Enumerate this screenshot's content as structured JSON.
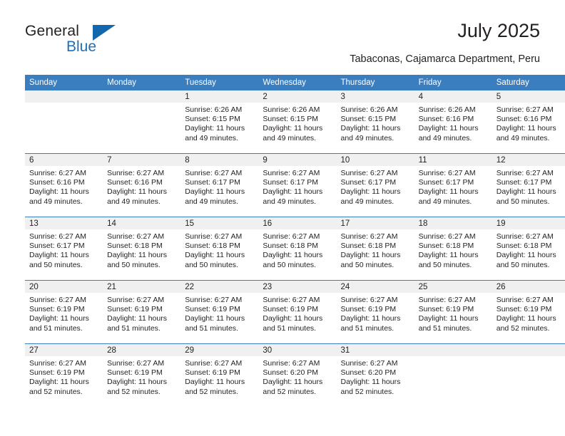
{
  "logo": {
    "word_one": "General",
    "word_two": "Blue",
    "triangle_icon": "triangle-icon",
    "brand_color": "#1368ad"
  },
  "header": {
    "title": "July 2025",
    "subtitle": "Tabaconas, Cajamarca Department, Peru"
  },
  "calendar": {
    "header_bg": "#3a7ebf",
    "daynum_band_bg": "#f0f0f0",
    "weekday_headers": [
      "Sunday",
      "Monday",
      "Tuesday",
      "Wednesday",
      "Thursday",
      "Friday",
      "Saturday"
    ],
    "weeks": [
      [
        {
          "day": "",
          "sunrise": "",
          "sunset": "",
          "daylight_line1": "",
          "daylight_line2": "",
          "empty": true
        },
        {
          "day": "",
          "sunrise": "",
          "sunset": "",
          "daylight_line1": "",
          "daylight_line2": "",
          "empty": true
        },
        {
          "day": "1",
          "sunrise": "Sunrise: 6:26 AM",
          "sunset": "Sunset: 6:15 PM",
          "daylight_line1": "Daylight: 11 hours",
          "daylight_line2": "and 49 minutes.",
          "empty": false
        },
        {
          "day": "2",
          "sunrise": "Sunrise: 6:26 AM",
          "sunset": "Sunset: 6:15 PM",
          "daylight_line1": "Daylight: 11 hours",
          "daylight_line2": "and 49 minutes.",
          "empty": false
        },
        {
          "day": "3",
          "sunrise": "Sunrise: 6:26 AM",
          "sunset": "Sunset: 6:15 PM",
          "daylight_line1": "Daylight: 11 hours",
          "daylight_line2": "and 49 minutes.",
          "empty": false
        },
        {
          "day": "4",
          "sunrise": "Sunrise: 6:26 AM",
          "sunset": "Sunset: 6:16 PM",
          "daylight_line1": "Daylight: 11 hours",
          "daylight_line2": "and 49 minutes.",
          "empty": false
        },
        {
          "day": "5",
          "sunrise": "Sunrise: 6:27 AM",
          "sunset": "Sunset: 6:16 PM",
          "daylight_line1": "Daylight: 11 hours",
          "daylight_line2": "and 49 minutes.",
          "empty": false
        }
      ],
      [
        {
          "day": "6",
          "sunrise": "Sunrise: 6:27 AM",
          "sunset": "Sunset: 6:16 PM",
          "daylight_line1": "Daylight: 11 hours",
          "daylight_line2": "and 49 minutes.",
          "empty": false
        },
        {
          "day": "7",
          "sunrise": "Sunrise: 6:27 AM",
          "sunset": "Sunset: 6:16 PM",
          "daylight_line1": "Daylight: 11 hours",
          "daylight_line2": "and 49 minutes.",
          "empty": false
        },
        {
          "day": "8",
          "sunrise": "Sunrise: 6:27 AM",
          "sunset": "Sunset: 6:17 PM",
          "daylight_line1": "Daylight: 11 hours",
          "daylight_line2": "and 49 minutes.",
          "empty": false
        },
        {
          "day": "9",
          "sunrise": "Sunrise: 6:27 AM",
          "sunset": "Sunset: 6:17 PM",
          "daylight_line1": "Daylight: 11 hours",
          "daylight_line2": "and 49 minutes.",
          "empty": false
        },
        {
          "day": "10",
          "sunrise": "Sunrise: 6:27 AM",
          "sunset": "Sunset: 6:17 PM",
          "daylight_line1": "Daylight: 11 hours",
          "daylight_line2": "and 49 minutes.",
          "empty": false
        },
        {
          "day": "11",
          "sunrise": "Sunrise: 6:27 AM",
          "sunset": "Sunset: 6:17 PM",
          "daylight_line1": "Daylight: 11 hours",
          "daylight_line2": "and 49 minutes.",
          "empty": false
        },
        {
          "day": "12",
          "sunrise": "Sunrise: 6:27 AM",
          "sunset": "Sunset: 6:17 PM",
          "daylight_line1": "Daylight: 11 hours",
          "daylight_line2": "and 50 minutes.",
          "empty": false
        }
      ],
      [
        {
          "day": "13",
          "sunrise": "Sunrise: 6:27 AM",
          "sunset": "Sunset: 6:17 PM",
          "daylight_line1": "Daylight: 11 hours",
          "daylight_line2": "and 50 minutes.",
          "empty": false
        },
        {
          "day": "14",
          "sunrise": "Sunrise: 6:27 AM",
          "sunset": "Sunset: 6:18 PM",
          "daylight_line1": "Daylight: 11 hours",
          "daylight_line2": "and 50 minutes.",
          "empty": false
        },
        {
          "day": "15",
          "sunrise": "Sunrise: 6:27 AM",
          "sunset": "Sunset: 6:18 PM",
          "daylight_line1": "Daylight: 11 hours",
          "daylight_line2": "and 50 minutes.",
          "empty": false
        },
        {
          "day": "16",
          "sunrise": "Sunrise: 6:27 AM",
          "sunset": "Sunset: 6:18 PM",
          "daylight_line1": "Daylight: 11 hours",
          "daylight_line2": "and 50 minutes.",
          "empty": false
        },
        {
          "day": "17",
          "sunrise": "Sunrise: 6:27 AM",
          "sunset": "Sunset: 6:18 PM",
          "daylight_line1": "Daylight: 11 hours",
          "daylight_line2": "and 50 minutes.",
          "empty": false
        },
        {
          "day": "18",
          "sunrise": "Sunrise: 6:27 AM",
          "sunset": "Sunset: 6:18 PM",
          "daylight_line1": "Daylight: 11 hours",
          "daylight_line2": "and 50 minutes.",
          "empty": false
        },
        {
          "day": "19",
          "sunrise": "Sunrise: 6:27 AM",
          "sunset": "Sunset: 6:18 PM",
          "daylight_line1": "Daylight: 11 hours",
          "daylight_line2": "and 50 minutes.",
          "empty": false
        }
      ],
      [
        {
          "day": "20",
          "sunrise": "Sunrise: 6:27 AM",
          "sunset": "Sunset: 6:19 PM",
          "daylight_line1": "Daylight: 11 hours",
          "daylight_line2": "and 51 minutes.",
          "empty": false
        },
        {
          "day": "21",
          "sunrise": "Sunrise: 6:27 AM",
          "sunset": "Sunset: 6:19 PM",
          "daylight_line1": "Daylight: 11 hours",
          "daylight_line2": "and 51 minutes.",
          "empty": false
        },
        {
          "day": "22",
          "sunrise": "Sunrise: 6:27 AM",
          "sunset": "Sunset: 6:19 PM",
          "daylight_line1": "Daylight: 11 hours",
          "daylight_line2": "and 51 minutes.",
          "empty": false
        },
        {
          "day": "23",
          "sunrise": "Sunrise: 6:27 AM",
          "sunset": "Sunset: 6:19 PM",
          "daylight_line1": "Daylight: 11 hours",
          "daylight_line2": "and 51 minutes.",
          "empty": false
        },
        {
          "day": "24",
          "sunrise": "Sunrise: 6:27 AM",
          "sunset": "Sunset: 6:19 PM",
          "daylight_line1": "Daylight: 11 hours",
          "daylight_line2": "and 51 minutes.",
          "empty": false
        },
        {
          "day": "25",
          "sunrise": "Sunrise: 6:27 AM",
          "sunset": "Sunset: 6:19 PM",
          "daylight_line1": "Daylight: 11 hours",
          "daylight_line2": "and 51 minutes.",
          "empty": false
        },
        {
          "day": "26",
          "sunrise": "Sunrise: 6:27 AM",
          "sunset": "Sunset: 6:19 PM",
          "daylight_line1": "Daylight: 11 hours",
          "daylight_line2": "and 52 minutes.",
          "empty": false
        }
      ],
      [
        {
          "day": "27",
          "sunrise": "Sunrise: 6:27 AM",
          "sunset": "Sunset: 6:19 PM",
          "daylight_line1": "Daylight: 11 hours",
          "daylight_line2": "and 52 minutes.",
          "empty": false
        },
        {
          "day": "28",
          "sunrise": "Sunrise: 6:27 AM",
          "sunset": "Sunset: 6:19 PM",
          "daylight_line1": "Daylight: 11 hours",
          "daylight_line2": "and 52 minutes.",
          "empty": false
        },
        {
          "day": "29",
          "sunrise": "Sunrise: 6:27 AM",
          "sunset": "Sunset: 6:19 PM",
          "daylight_line1": "Daylight: 11 hours",
          "daylight_line2": "and 52 minutes.",
          "empty": false
        },
        {
          "day": "30",
          "sunrise": "Sunrise: 6:27 AM",
          "sunset": "Sunset: 6:20 PM",
          "daylight_line1": "Daylight: 11 hours",
          "daylight_line2": "and 52 minutes.",
          "empty": false
        },
        {
          "day": "31",
          "sunrise": "Sunrise: 6:27 AM",
          "sunset": "Sunset: 6:20 PM",
          "daylight_line1": "Daylight: 11 hours",
          "daylight_line2": "and 52 minutes.",
          "empty": false
        },
        {
          "day": "",
          "sunrise": "",
          "sunset": "",
          "daylight_line1": "",
          "daylight_line2": "",
          "empty": true
        },
        {
          "day": "",
          "sunrise": "",
          "sunset": "",
          "daylight_line1": "",
          "daylight_line2": "",
          "empty": true
        }
      ]
    ]
  }
}
